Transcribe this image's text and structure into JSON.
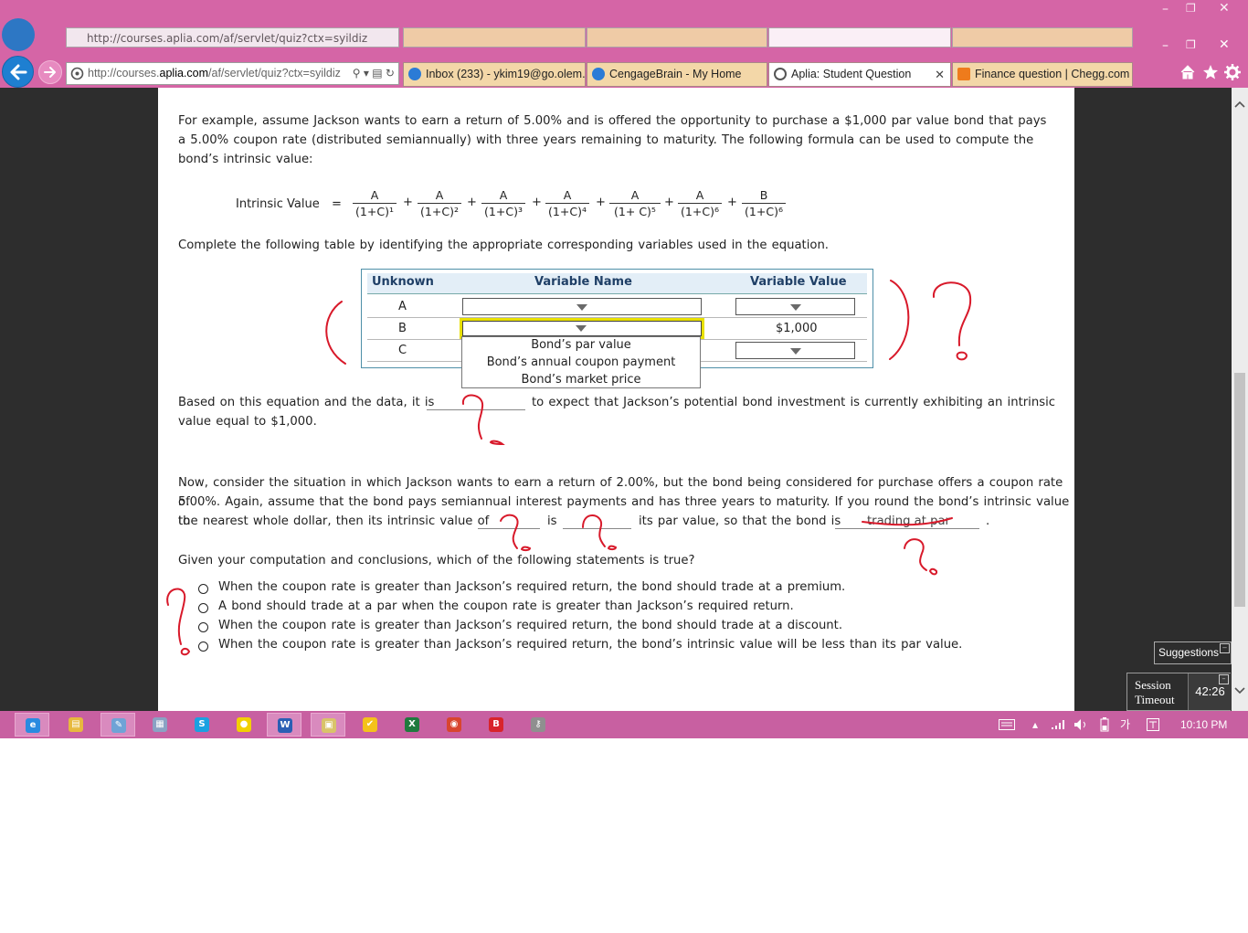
{
  "browser": {
    "ghost_url": "http://courses.aplia.com/af/servlet/quiz?ctx=syildiz",
    "url_prefix": "http://courses.",
    "url_domain": "aplia.com",
    "url_path": "/af/servlet/quiz?ctx=syildiz",
    "url_icons": "⚲ ▾ ▤ ↻",
    "tabs": [
      {
        "label": "Inbox (233) - ykim19@go.olem...",
        "icon_color": "#2b7bd6",
        "active": false
      },
      {
        "label": "CengageBrain - My Home",
        "icon_color": "#2b7bd6",
        "active": false
      },
      {
        "label": "Aplia: Student Question",
        "icon_color": "#555555",
        "active": true
      },
      {
        "label": "Finance question | Chegg.com",
        "icon_color": "#ee7b1c",
        "active": false
      }
    ],
    "close_glyph": "✕",
    "right_icons": [
      "home-icon",
      "star-icon",
      "gear-icon"
    ]
  },
  "question": {
    "intro": "For example, assume Jackson wants to earn a return of 5.00% and is offered the opportunity to purchase a $1,000 par value bond that pays a 5.00% coupon rate (distributed semiannually) with three years remaining to maturity. The following formula can be used to compute the bond’s intrinsic value:",
    "formula_label": "Intrinsic Value",
    "formula_eq": "=",
    "terms": [
      {
        "num": "A",
        "den": "(1+C)¹"
      },
      {
        "num": "A",
        "den": "(1+C)²"
      },
      {
        "num": "A",
        "den": "(1+C)³"
      },
      {
        "num": "A",
        "den": "(1+C)⁴"
      },
      {
        "num": "A",
        "den": "(1+ C)⁵"
      },
      {
        "num": "A",
        "den": "(1+C)⁶"
      },
      {
        "num": "B",
        "den": "(1+C)⁶"
      }
    ],
    "plus": "+",
    "table_prompt": "Complete the following table by identifying the appropriate corresponding variables used in the equation.",
    "table": {
      "headers": [
        "Unknown",
        "Variable Name",
        "Variable Value"
      ],
      "rows": [
        {
          "unknown": "A",
          "value": ""
        },
        {
          "unknown": "B",
          "value": "$1,000"
        },
        {
          "unknown": "C",
          "value": ""
        }
      ],
      "dropdown_options": [
        "Bond’s par value",
        "Bond’s annual coupon payment",
        "Bond’s market price"
      ]
    },
    "based_on_part1": "Based on this equation and the data, it is",
    "based_on_part2": "to expect that Jackson’s potential bond investment is currently exhibiting an intrinsic",
    "based_on_part3": "value equal to $1,000.",
    "now_line1": "Now, consider the situation in which Jackson wants to earn a return of 2.00%, but the bond being considered for purchase offers a coupon rate of",
    "now_line2": "5.00%. Again, assume that the bond pays semiannual interest payments and has three years to maturity. If you round the bond’s intrinsic value to",
    "now_line3a": "the nearest whole dollar, then its intrinsic value of",
    "now_line3b": "is",
    "now_line3c": "its par value, so that the bond is",
    "trading_at_par": "trading at par",
    "period": ".",
    "given_prompt": "Given your computation and conclusions, which of the following statements is true?",
    "options": [
      "When the coupon rate is greater than Jackson’s required return, the bond should trade at a premium.",
      "A bond should trade at a par when the coupon rate is greater than Jackson’s required return.",
      "When the coupon rate is greater than Jackson’s required return, the bond should trade at a discount.",
      "When the coupon rate is greater than Jackson’s required return, the bond’s intrinsic value will be less than its par value."
    ]
  },
  "widgets": {
    "suggestions": "Suggestions",
    "session_timeout_line1": "Session",
    "session_timeout_line2": "Timeout",
    "session_time": "42:26",
    "min_glyph": "–"
  },
  "taskbar": {
    "clock": "10:10 PM",
    "ime": "가",
    "apps": [
      {
        "name": "ie",
        "glyph": "e",
        "color": "#2a8be0",
        "open": true
      },
      {
        "name": "explorer",
        "glyph": "▤",
        "color": "#e7b93e",
        "open": false
      },
      {
        "name": "paint",
        "glyph": "✎",
        "color": "#6fa3d6",
        "open": true
      },
      {
        "name": "calculator",
        "glyph": "▦",
        "color": "#8aa2c4",
        "open": false
      },
      {
        "name": "skype",
        "glyph": "S",
        "color": "#1aa1e1",
        "open": false
      },
      {
        "name": "kakaotalk",
        "glyph": "●",
        "color": "#f2d000",
        "open": false
      },
      {
        "name": "word",
        "glyph": "W",
        "color": "#2b5fb4",
        "open": true
      },
      {
        "name": "files",
        "glyph": "▣",
        "color": "#d9c36a",
        "open": true
      },
      {
        "name": "norton",
        "glyph": "✔",
        "color": "#f4c21b",
        "open": false
      },
      {
        "name": "excel",
        "glyph": "X",
        "color": "#1f7a3e",
        "open": false
      },
      {
        "name": "chrome",
        "glyph": "◉",
        "color": "#d8452e",
        "open": false
      },
      {
        "name": "bandizip",
        "glyph": "B",
        "color": "#d8242b",
        "open": false
      },
      {
        "name": "usb",
        "glyph": "⚷",
        "color": "#8f8f8f",
        "open": false
      }
    ]
  },
  "colors": {
    "chrome_pink": "#d565a6",
    "annotation_red": "#d8192a",
    "page_dark": "#2d2d2d"
  }
}
